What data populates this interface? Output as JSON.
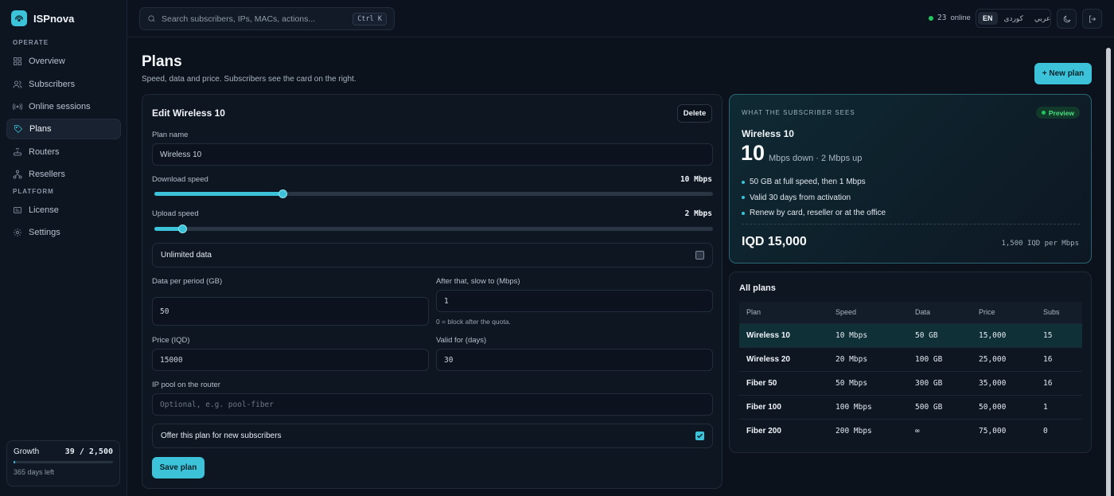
{
  "brand": {
    "name": "ISPnova"
  },
  "sidebar": {
    "sections": [
      "OPERATE",
      "PLATFORM"
    ],
    "items": [
      {
        "label": "Overview",
        "icon": "grid-icon"
      },
      {
        "label": "Subscribers",
        "icon": "users-icon"
      },
      {
        "label": "Online sessions",
        "icon": "broadcast-icon"
      },
      {
        "label": "Plans",
        "icon": "tag-icon",
        "active": true
      },
      {
        "label": "Routers",
        "icon": "router-icon"
      },
      {
        "label": "Resellers",
        "icon": "network-icon"
      },
      {
        "label": "License",
        "icon": "license-icon"
      },
      {
        "label": "Settings",
        "icon": "gear-icon"
      }
    ],
    "growth": {
      "label": "Growth",
      "count": "39 / 2,500",
      "progress": 0.0156,
      "days_left": "365 days left"
    }
  },
  "topbar": {
    "search_placeholder": "Search subscribers, IPs, MACs, actions...",
    "shortcut": "Ctrl K",
    "online_count": "23",
    "online_label": "online",
    "languages": [
      "EN",
      "کوردی",
      "عربي"
    ],
    "active_language": "EN"
  },
  "page": {
    "title": "Plans",
    "subtitle": "Speed, data and price. Subscribers see the card on the right.",
    "new_plan_label": "+ New plan"
  },
  "edit": {
    "title": "Edit Wireless 10",
    "delete_label": "Delete",
    "plan_name_label": "Plan name",
    "plan_name_value": "Wireless 10",
    "download_label": "Download speed",
    "download_value": "10 Mbps",
    "download_fraction": 0.23,
    "upload_label": "Upload speed",
    "upload_value": "2 Mbps",
    "upload_fraction": 0.05,
    "unlimited_label": "Unlimited data",
    "unlimited_checked": false,
    "data_label": "Data per period (GB)",
    "data_value": "50",
    "slow_label": "After that, slow to (Mbps)",
    "slow_value": "1",
    "slow_hint": "0 = block after the quota.",
    "price_label": "Price (IQD)",
    "price_value": "15000",
    "valid_label": "Valid for (days)",
    "valid_value": "30",
    "pool_label": "IP pool on the router",
    "pool_placeholder": "Optional, e.g. pool-fiber",
    "offer_label": "Offer this plan for new subscribers",
    "offer_checked": true,
    "save_label": "Save plan"
  },
  "preview": {
    "eyebrow": "WHAT THE SUBSCRIBER SEES",
    "badge": "Preview",
    "name": "Wireless 10",
    "big_number": "10",
    "speed_text": "Mbps down · 2 Mbps up",
    "bullets": [
      "50 GB at full speed, then 1 Mbps",
      "Valid 30 days from activation",
      "Renew by card, reseller or at the office"
    ],
    "price": "IQD 15,000",
    "per_mbps": "1,500 IQD per Mbps"
  },
  "all_plans": {
    "title": "All plans",
    "columns": [
      "Plan",
      "Speed",
      "Data",
      "Price",
      "Subs"
    ],
    "rows": [
      [
        "Wireless 10",
        "10 Mbps",
        "50 GB",
        "15,000",
        "15"
      ],
      [
        "Wireless 20",
        "20 Mbps",
        "100 GB",
        "25,000",
        "16"
      ],
      [
        "Fiber 50",
        "50 Mbps",
        "300 GB",
        "35,000",
        "16"
      ],
      [
        "Fiber 100",
        "100 Mbps",
        "500 GB",
        "50,000",
        "1"
      ],
      [
        "Fiber 200",
        "200 Mbps",
        "∞",
        "75,000",
        "0"
      ]
    ],
    "selected_row": 0
  },
  "colors": {
    "accent": "#3cc3d9",
    "online": "#22c55e",
    "background": "#0b121c"
  }
}
